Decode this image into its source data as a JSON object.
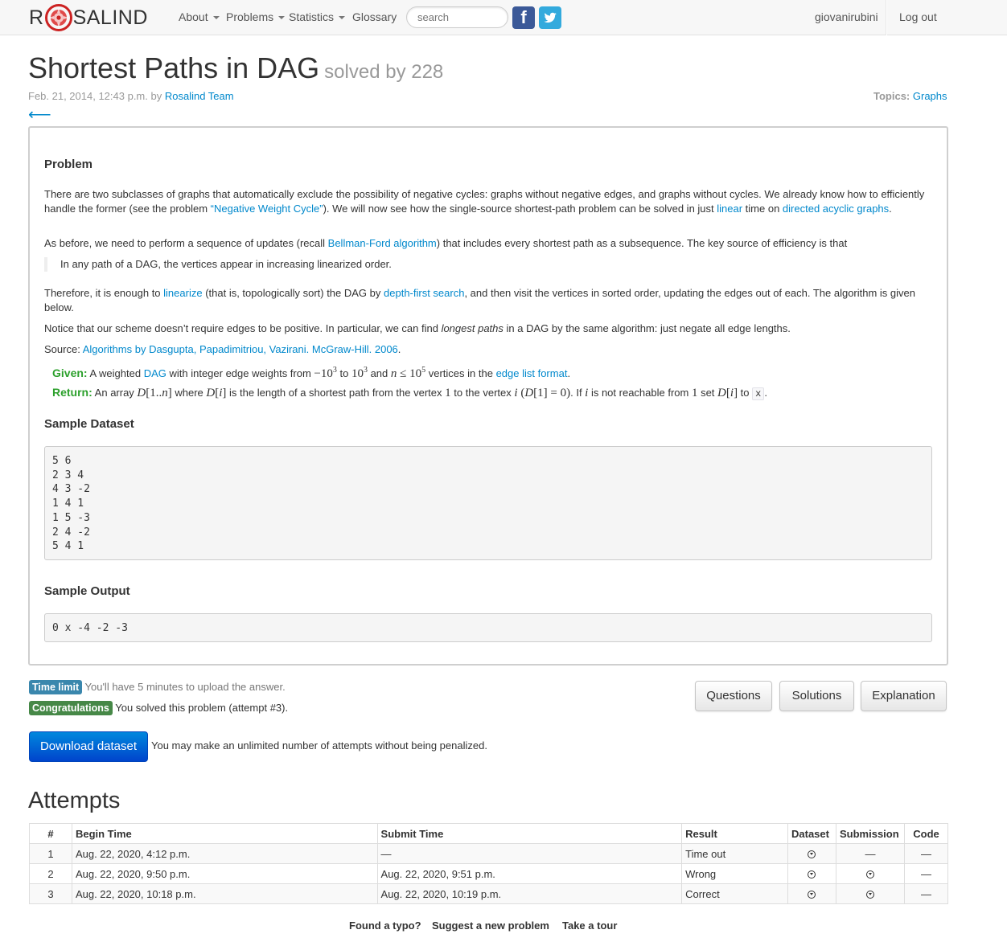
{
  "nav": {
    "logo_left": "R",
    "logo_right": "SALIND",
    "items": [
      "About",
      "Problems",
      "Statistics",
      "Glossary"
    ],
    "search_placeholder": "search",
    "facebook": "f",
    "twitter": "t",
    "user": "giovanirubini",
    "logout": "Log out",
    "colors": {
      "facebook": "#3b5998",
      "twitter": "#33aadd",
      "logo_red": "#cc2222"
    }
  },
  "header": {
    "title": "Shortest Paths in DAG",
    "solved_by": "solved by 228",
    "date": "Feb. 21, 2014, 12:43 p.m. by ",
    "author": "Rosalind Team",
    "topics_label": "Topics:",
    "topics_value": "Graphs",
    "back_arrow": "⟵"
  },
  "problem": {
    "heading": "Problem",
    "p1_a": "There are two subclasses of graphs that automatically exclude the possibility of negative cycles: graphs without negative edges, and graphs without cycles. We already know how to efficiently handle the former (see the problem ",
    "p1_link1": "“Negative Weight Cycle”",
    "p1_b": "). We will now see how the single-source shortest-path problem can be solved in just ",
    "p1_link2": "linear",
    "p1_c": " time on ",
    "p1_link3": "directed acyclic graphs",
    "p1_d": ".",
    "p2_a": "As before, we need to perform a sequence of updates (recall ",
    "p2_link": "Bellman-Ford algorithm",
    "p2_b": ") that includes every shortest path as a subsequence. The key source of efficiency is that",
    "quote": "In any path of a DAG, the vertices appear in increasing linearized order.",
    "p3_a": "Therefore, it is enough to ",
    "p3_link1": "linearize",
    "p3_b": " (that is, topologically sort) the DAG by ",
    "p3_link2": "depth-first search",
    "p3_c": ", and then visit the vertices in sorted order, updating the edges out of each. The algorithm is given below.",
    "p4_a": "Notice that our scheme doesn’t require edges to be positive. In particular, we can find ",
    "p4_em": "longest paths",
    "p4_b": " in a DAG by the same algorithm: just negate all edge lengths.",
    "source_label": "Source: ",
    "source_link": "Algorithms by Dasgupta, Papadimitriou, Vazirani. McGraw-Hill. 2006",
    "source_end": ".",
    "given_label": "Given:",
    "given_a": " A weighted ",
    "given_link1": "DAG",
    "given_b": " with integer edge weights from ",
    "given_c": " to ",
    "given_d": " and ",
    "given_e": " vertices in the ",
    "given_link2": "edge list format",
    "given_f": ".",
    "return_label": "Return:",
    "return_a": " An array ",
    "return_b": " where ",
    "return_c": " is the length of a shortest path from the vertex ",
    "return_d": " to the vertex ",
    "return_e": ". If ",
    "return_f": " is not reachable from ",
    "return_g": " set ",
    "return_h": " to ",
    "return_x": "x",
    "return_end": ".",
    "sample_dataset_heading": "Sample Dataset",
    "sample_dataset": "5 6\n2 3 4\n4 3 -2\n1 4 1\n1 5 -3\n2 4 -2\n5 4 1",
    "sample_output_heading": "Sample Output",
    "sample_output": "0 x -4 -2 -3"
  },
  "status": {
    "time_limit_label": "Time limit",
    "time_limit_text": "You'll have 5 minutes to upload the answer.",
    "congrats_label": "Congratulations",
    "congrats_text": "You solved this problem (attempt #3).",
    "download_button": "Download dataset",
    "attempts_note": "You may make an unlimited number of attempts without being penalized.",
    "buttons": [
      "Questions",
      "Solutions",
      "Explanation"
    ]
  },
  "attempts": {
    "title": "Attempts",
    "columns": [
      "#",
      "Begin Time",
      "Submit Time",
      "Result",
      "Dataset",
      "Submission",
      "Code"
    ],
    "rows": [
      {
        "n": "1",
        "begin": "Aug. 22, 2020, 4:12 p.m.",
        "submit": "—",
        "result": "Time out",
        "submission": "—",
        "code": "—"
      },
      {
        "n": "2",
        "begin": "Aug. 22, 2020, 9:50 p.m.",
        "submit": "Aug. 22, 2020, 9:51 p.m.",
        "result": "Wrong",
        "submission": "download",
        "code": "—"
      },
      {
        "n": "3",
        "begin": "Aug. 22, 2020, 10:18 p.m.",
        "submit": "Aug. 22, 2020, 10:19 p.m.",
        "result": "Correct",
        "submission": "download",
        "code": "—"
      }
    ]
  },
  "footer": {
    "links": [
      "Found a typo?",
      "Suggest a new problem",
      "Take a tour"
    ]
  }
}
